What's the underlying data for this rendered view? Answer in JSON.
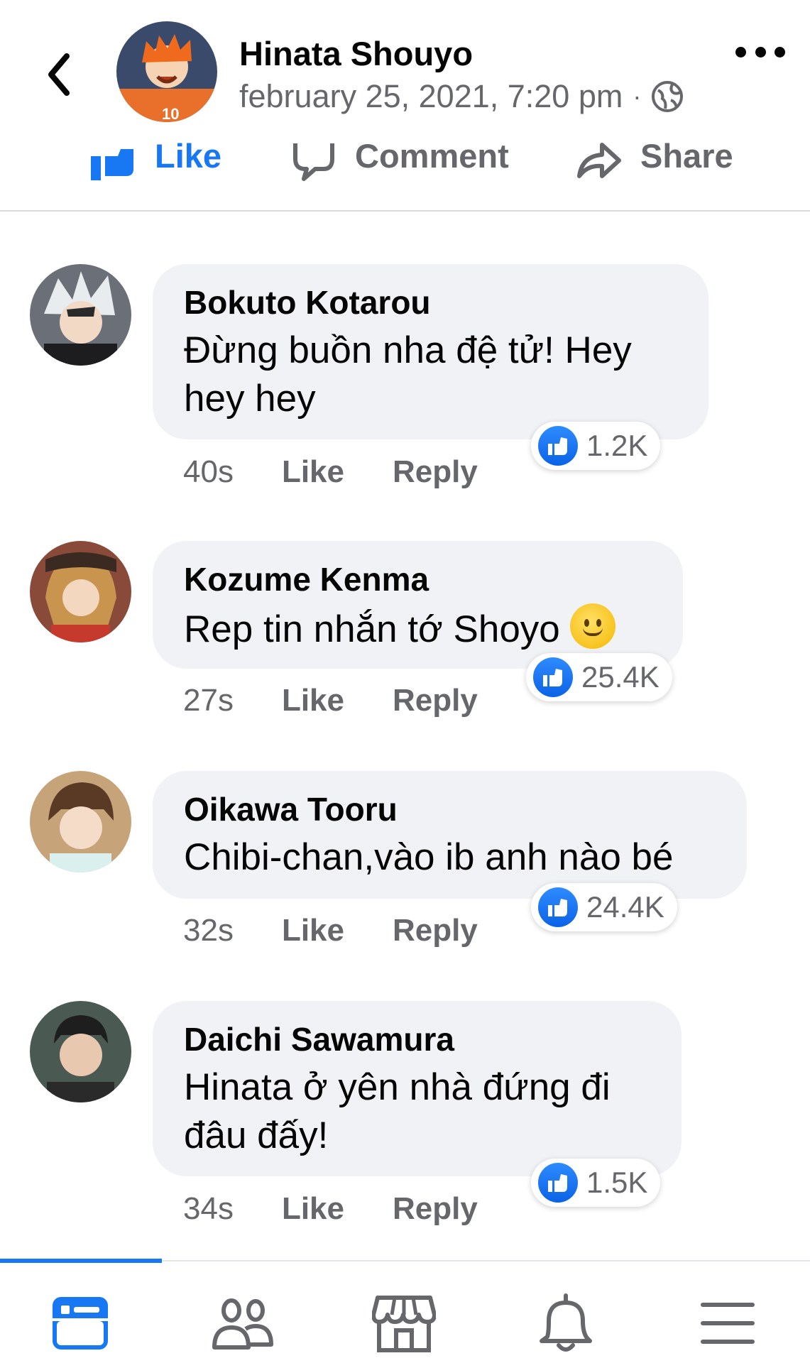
{
  "header": {
    "name": "Hinata Shouyo",
    "date": "february 25, 2021, 7:20 pm",
    "separator": "·",
    "avatar_icon": "avatar-hinata"
  },
  "actions": {
    "like": "Like",
    "comment": "Comment",
    "share": "Share"
  },
  "comments": [
    {
      "author": "Bokuto Kotarou",
      "text_line1": "Đừng buồn nha đệ tử! Hey",
      "text_line2": "hey hey",
      "time": "40s",
      "like": "Like",
      "reply": "Reply",
      "reactions": "1.2K"
    },
    {
      "author": "Kozume Kenma",
      "text_line1": "Rep tin nhắn tớ Shoyo",
      "time": "27s",
      "like": "Like",
      "reply": "Reply",
      "reactions": "25.4K",
      "emoji": "slightly-smiling-face"
    },
    {
      "author": "Oikawa Tooru",
      "text_line1": "Chibi-chan,vào ib anh nào bé",
      "time": "32s",
      "like": "Like",
      "reply": "Reply",
      "reactions": "24.4K"
    },
    {
      "author": "Daichi Sawamura",
      "text_line1": "Hinata ở yên nhà đứng đi",
      "text_line2": "đâu đấy!",
      "time": "34s",
      "like": "Like",
      "reply": "Reply",
      "reactions": "1.5K"
    }
  ],
  "bottom_nav": {
    "items": [
      "news-feed-icon",
      "friends-icon",
      "marketplace-icon",
      "notifications-icon",
      "menu-icon"
    ],
    "active_index": 0
  },
  "colors": {
    "accent": "#1877f2",
    "bubble": "#f0f2f5",
    "muted": "#65676b"
  }
}
